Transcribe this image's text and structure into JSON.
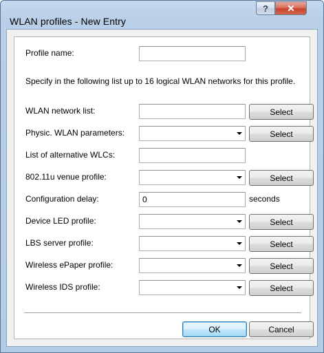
{
  "window": {
    "title": "WLAN profiles - New Entry",
    "help_label": "?",
    "close_label": "✕"
  },
  "form": {
    "description": "Specify in the following list up to 16 logical WLAN networks for this profile.",
    "fields": {
      "profile_name": {
        "label": "Profile name:",
        "value": ""
      },
      "wlan_network_list": {
        "label": "WLAN network list:",
        "value": "",
        "button": "Select"
      },
      "physic_wlan_parameters": {
        "label": "Physic. WLAN parameters:",
        "value": "",
        "button": "Select"
      },
      "alternative_wlcs": {
        "label": "List of alternative WLCs:",
        "value": ""
      },
      "venue_profile": {
        "label": "802.11u venue profile:",
        "value": "",
        "button": "Select"
      },
      "configuration_delay": {
        "label": "Configuration delay:",
        "value": "0",
        "unit": "seconds"
      },
      "device_led_profile": {
        "label": "Device LED profile:",
        "value": "",
        "button": "Select"
      },
      "lbs_server_profile": {
        "label": "LBS server profile:",
        "value": "",
        "button": "Select"
      },
      "wireless_epaper_profile": {
        "label": "Wireless ePaper profile:",
        "value": "",
        "button": "Select"
      },
      "wireless_ids_profile": {
        "label": "Wireless IDS profile:",
        "value": "",
        "button": "Select"
      }
    }
  },
  "buttons": {
    "ok": "OK",
    "cancel": "Cancel"
  },
  "icons": {
    "help": "help-icon",
    "close": "close-icon",
    "dropdown": "chevron-down-icon"
  }
}
